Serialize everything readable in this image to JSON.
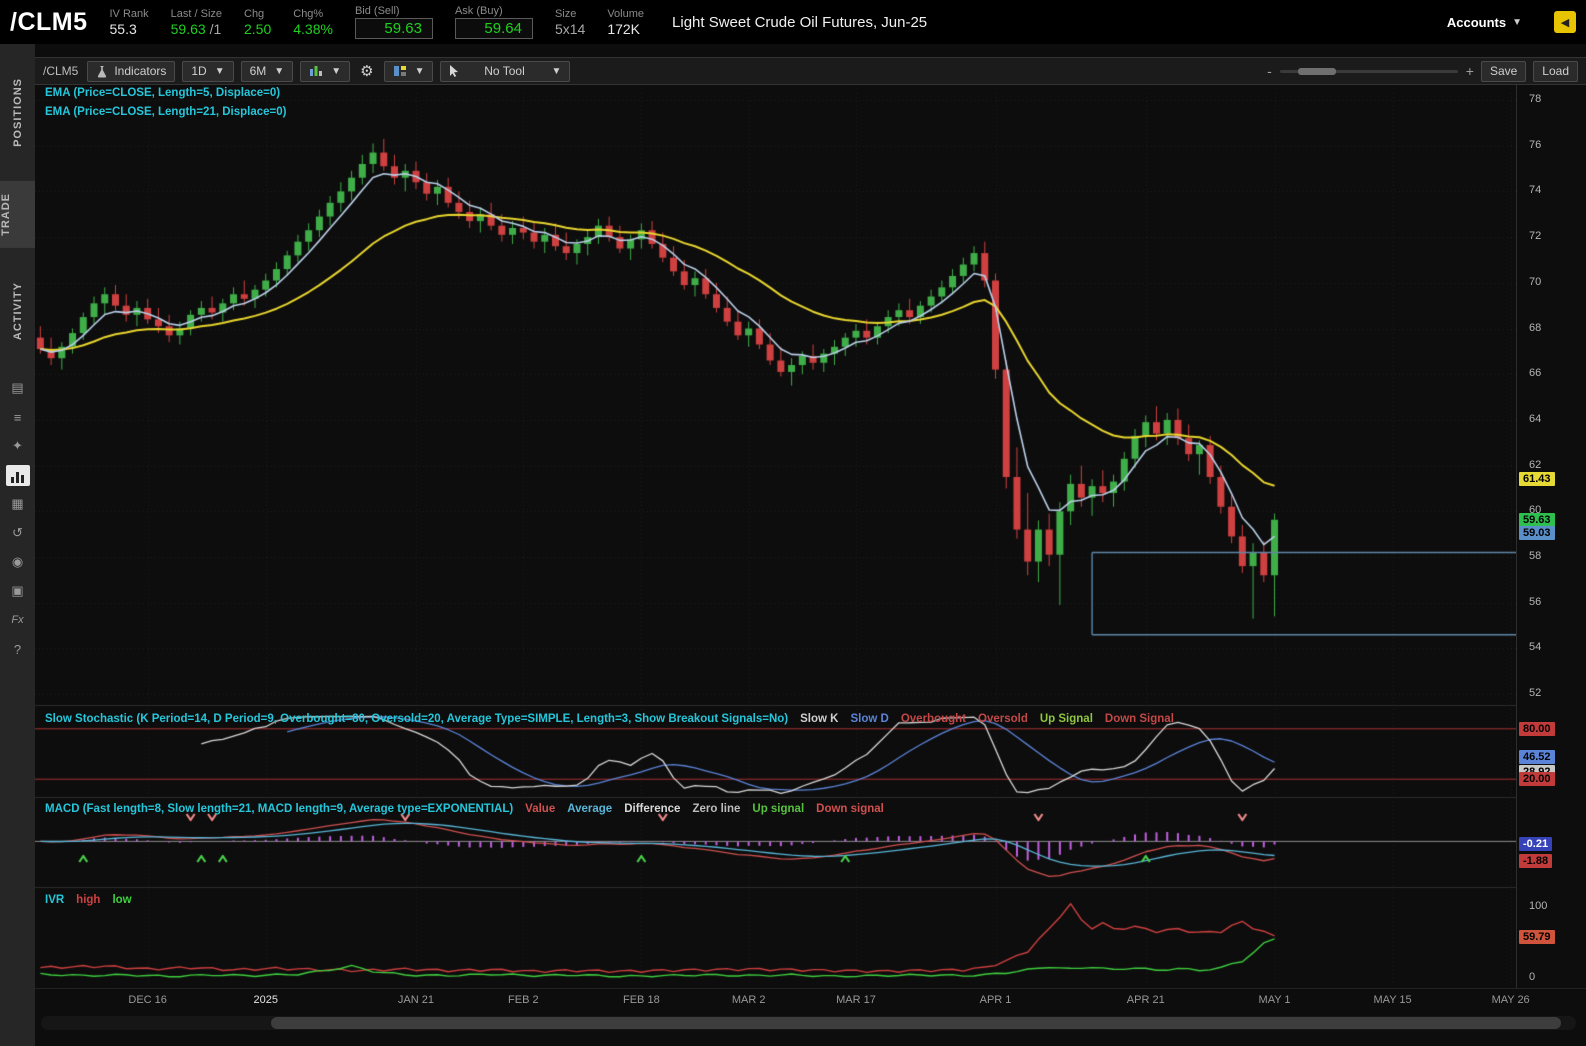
{
  "header": {
    "symbol": "/CLM5",
    "iv_rank_label": "IV Rank",
    "iv_rank": "55.3",
    "last_label": "Last / Size",
    "last": "59.63",
    "last_size": "/1",
    "chg_label": "Chg",
    "chg": "2.50",
    "chgpct_label": "Chg%",
    "chgpct": "4.38%",
    "bid_label": "Bid (Sell)",
    "bid": "59.63",
    "ask_label": "Ask (Buy)",
    "ask": "59.64",
    "size_label": "Size",
    "size": "5x14",
    "volume_label": "Volume",
    "volume": "172K",
    "description": "Light Sweet Crude Oil Futures, Jun-25",
    "accounts_label": "Accounts"
  },
  "sidebar": {
    "tabs": [
      {
        "label": "POSITIONS"
      },
      {
        "label": "TRADE"
      },
      {
        "label": "ACTIVITY"
      }
    ],
    "icons": [
      "calendar-icon",
      "watchlist-icon",
      "scan-icon",
      "chart-icon",
      "grid-icon",
      "history-icon",
      "community-icon",
      "products-icon",
      "formula-icon",
      "help-icon"
    ]
  },
  "toolbar": {
    "symbol_label": "/CLM5",
    "indicators_label": "Indicators",
    "timeframe": "1D",
    "range": "6M",
    "tool_label": "No Tool",
    "save_label": "Save",
    "load_label": "Load",
    "zoom_out": "-",
    "zoom_in": "+"
  },
  "chart_data": {
    "type": "candlestick",
    "symbol": "/CLM5",
    "timeframe": "1D",
    "range": "6M",
    "legend_color": "#26c6da",
    "colors": {
      "candle_up": "#3fae49",
      "candle_down": "#cf4040",
      "ema5_line": "#b9cfe8",
      "ema21_line": "#e8d52e",
      "drawing_line": "#5f87a8",
      "macd_histogram": "#c060e0"
    },
    "overlays": [
      {
        "name": "EMA 5",
        "legend": "EMA (Price=CLOSE, Length=5, Displace=0)",
        "length": 5,
        "color": "#b9cfe8"
      },
      {
        "name": "EMA 21",
        "legend": "EMA (Price=CLOSE, Length=21, Displace=0)",
        "length": 21,
        "color": "#e8d52e"
      }
    ],
    "price_axis": {
      "ticks": [
        78,
        76,
        74,
        72,
        70,
        68,
        66,
        64,
        62,
        60,
        58,
        56,
        54,
        52
      ],
      "badges": [
        {
          "text": "61.43",
          "price": 61.43,
          "bg": "#e6d835",
          "fg": "#000",
          "name": "ema21-value-badge"
        },
        {
          "text": "59.63",
          "price": 59.63,
          "bg": "#2fbf4f",
          "fg": "#000",
          "name": "last-price-badge"
        },
        {
          "text": "59.03",
          "price": 59.03,
          "bg": "#5b8fc9",
          "fg": "#000",
          "name": "ema5-value-badge"
        }
      ]
    },
    "drawings": {
      "upper_line_price": 58.2,
      "lower_line_price": 54.6,
      "start_index": 98
    },
    "x_axis": {
      "total_slots": 138,
      "ticks": [
        {
          "label": "DEC 16",
          "index": 10
        },
        {
          "label": "2025",
          "index": 21,
          "bright": true
        },
        {
          "label": "JAN 21",
          "index": 35
        },
        {
          "label": "FEB 2",
          "index": 45
        },
        {
          "label": "FEB 18",
          "index": 56
        },
        {
          "label": "MAR 2",
          "index": 66
        },
        {
          "label": "MAR 17",
          "index": 76
        },
        {
          "label": "APR 1",
          "index": 89
        },
        {
          "label": "APR 21",
          "index": 103
        },
        {
          "label": "MAY 1",
          "index": 115
        },
        {
          "label": "MAY 15",
          "index": 126
        },
        {
          "label": "MAY 26",
          "index": 137
        }
      ]
    },
    "candles": [
      [
        67.6,
        68.1,
        66.9,
        67.1
      ],
      [
        67.1,
        67.6,
        66.4,
        66.7
      ],
      [
        66.7,
        67.4,
        66.2,
        67.2
      ],
      [
        67.2,
        68.0,
        66.9,
        67.8
      ],
      [
        67.8,
        68.7,
        67.5,
        68.5
      ],
      [
        68.5,
        69.4,
        68.2,
        69.1
      ],
      [
        69.1,
        69.8,
        68.6,
        69.5
      ],
      [
        69.5,
        69.9,
        68.8,
        69.0
      ],
      [
        69.0,
        69.5,
        68.3,
        68.6
      ],
      [
        68.6,
        69.2,
        68.1,
        68.9
      ],
      [
        68.9,
        69.3,
        68.2,
        68.4
      ],
      [
        68.4,
        68.9,
        67.8,
        68.1
      ],
      [
        68.1,
        68.6,
        67.4,
        67.7
      ],
      [
        67.7,
        68.3,
        67.3,
        68.0
      ],
      [
        68.0,
        68.8,
        67.7,
        68.6
      ],
      [
        68.6,
        69.2,
        68.3,
        68.9
      ],
      [
        68.9,
        69.4,
        68.4,
        68.7
      ],
      [
        68.7,
        69.3,
        68.3,
        69.1
      ],
      [
        69.1,
        69.8,
        68.8,
        69.5
      ],
      [
        69.5,
        70.1,
        69.0,
        69.3
      ],
      [
        69.3,
        69.9,
        68.9,
        69.7
      ],
      [
        69.7,
        70.4,
        69.4,
        70.1
      ],
      [
        70.1,
        70.9,
        69.8,
        70.6
      ],
      [
        70.6,
        71.4,
        70.3,
        71.2
      ],
      [
        71.2,
        72.1,
        70.9,
        71.8
      ],
      [
        71.8,
        72.6,
        71.4,
        72.3
      ],
      [
        72.3,
        73.2,
        72.0,
        72.9
      ],
      [
        72.9,
        73.8,
        72.5,
        73.5
      ],
      [
        73.5,
        74.4,
        73.1,
        74.0
      ],
      [
        74.0,
        74.9,
        73.6,
        74.6
      ],
      [
        74.6,
        75.6,
        74.3,
        75.2
      ],
      [
        75.2,
        76.1,
        74.8,
        75.7
      ],
      [
        75.7,
        76.3,
        74.9,
        75.1
      ],
      [
        75.1,
        75.6,
        74.3,
        74.6
      ],
      [
        74.6,
        75.2,
        74.0,
        74.9
      ],
      [
        74.9,
        75.3,
        74.1,
        74.4
      ],
      [
        74.4,
        74.8,
        73.6,
        73.9
      ],
      [
        73.9,
        74.5,
        73.4,
        74.2
      ],
      [
        74.2,
        74.6,
        73.3,
        73.5
      ],
      [
        73.5,
        74.0,
        72.8,
        73.1
      ],
      [
        73.1,
        73.6,
        72.4,
        72.7
      ],
      [
        72.7,
        73.3,
        72.2,
        73.0
      ],
      [
        73.0,
        73.5,
        72.3,
        72.5
      ],
      [
        72.5,
        73.0,
        71.8,
        72.1
      ],
      [
        72.1,
        72.7,
        71.7,
        72.4
      ],
      [
        72.4,
        72.9,
        71.9,
        72.2
      ],
      [
        72.2,
        72.7,
        71.5,
        71.8
      ],
      [
        71.8,
        72.4,
        71.3,
        72.1
      ],
      [
        72.1,
        72.6,
        71.4,
        71.6
      ],
      [
        71.6,
        72.2,
        71.0,
        71.3
      ],
      [
        71.3,
        71.9,
        70.8,
        71.7
      ],
      [
        71.7,
        72.3,
        71.2,
        72.0
      ],
      [
        72.0,
        72.8,
        71.7,
        72.5
      ],
      [
        72.5,
        72.9,
        71.8,
        72.0
      ],
      [
        72.0,
        72.5,
        71.3,
        71.5
      ],
      [
        71.5,
        72.1,
        71.0,
        71.9
      ],
      [
        71.9,
        72.6,
        71.5,
        72.3
      ],
      [
        72.3,
        72.7,
        71.5,
        71.7
      ],
      [
        71.7,
        72.2,
        70.9,
        71.1
      ],
      [
        71.1,
        71.6,
        70.3,
        70.5
      ],
      [
        70.5,
        71.0,
        69.7,
        69.9
      ],
      [
        69.9,
        70.5,
        69.4,
        70.2
      ],
      [
        70.2,
        70.6,
        69.3,
        69.5
      ],
      [
        69.5,
        70.0,
        68.7,
        68.9
      ],
      [
        68.9,
        69.4,
        68.1,
        68.3
      ],
      [
        68.3,
        68.8,
        67.5,
        67.7
      ],
      [
        67.7,
        68.3,
        67.2,
        68.0
      ],
      [
        68.0,
        68.4,
        67.1,
        67.3
      ],
      [
        67.3,
        67.8,
        66.4,
        66.6
      ],
      [
        66.6,
        67.2,
        65.9,
        66.1
      ],
      [
        66.1,
        66.7,
        65.5,
        66.4
      ],
      [
        66.4,
        67.0,
        66.0,
        66.8
      ],
      [
        66.8,
        67.3,
        66.2,
        66.5
      ],
      [
        66.5,
        67.1,
        66.1,
        66.9
      ],
      [
        66.9,
        67.5,
        66.4,
        67.2
      ],
      [
        67.2,
        67.8,
        66.8,
        67.6
      ],
      [
        67.6,
        68.2,
        67.2,
        67.9
      ],
      [
        67.9,
        68.4,
        67.3,
        67.6
      ],
      [
        67.6,
        68.3,
        67.3,
        68.1
      ],
      [
        68.1,
        68.8,
        67.8,
        68.5
      ],
      [
        68.5,
        69.1,
        68.1,
        68.8
      ],
      [
        68.8,
        69.3,
        68.2,
        68.5
      ],
      [
        68.5,
        69.2,
        68.2,
        69.0
      ],
      [
        69.0,
        69.7,
        68.7,
        69.4
      ],
      [
        69.4,
        70.1,
        69.1,
        69.8
      ],
      [
        69.8,
        70.6,
        69.5,
        70.3
      ],
      [
        70.3,
        71.1,
        70.0,
        70.8
      ],
      [
        70.8,
        71.6,
        70.5,
        71.3
      ],
      [
        71.3,
        71.8,
        69.8,
        70.1
      ],
      [
        70.1,
        70.4,
        65.8,
        66.2
      ],
      [
        66.2,
        66.6,
        61.0,
        61.5
      ],
      [
        61.5,
        62.8,
        58.8,
        59.2
      ],
      [
        59.2,
        60.8,
        57.2,
        57.8
      ],
      [
        57.8,
        59.6,
        56.9,
        59.2
      ],
      [
        59.2,
        59.9,
        57.6,
        58.1
      ],
      [
        58.1,
        60.4,
        55.9,
        60.0
      ],
      [
        60.0,
        61.6,
        59.4,
        61.2
      ],
      [
        61.2,
        62.0,
        60.2,
        60.6
      ],
      [
        60.6,
        61.4,
        59.8,
        61.1
      ],
      [
        61.1,
        61.8,
        60.4,
        60.8
      ],
      [
        60.8,
        61.6,
        60.2,
        61.3
      ],
      [
        61.3,
        62.6,
        60.9,
        62.3
      ],
      [
        62.3,
        63.6,
        61.9,
        63.3
      ],
      [
        63.3,
        64.2,
        62.8,
        63.9
      ],
      [
        63.9,
        64.6,
        63.1,
        63.4
      ],
      [
        63.4,
        64.3,
        62.9,
        64.0
      ],
      [
        64.0,
        64.5,
        62.9,
        63.2
      ],
      [
        63.2,
        63.8,
        62.2,
        62.5
      ],
      [
        62.5,
        63.1,
        61.6,
        62.9
      ],
      [
        62.9,
        63.3,
        61.2,
        61.5
      ],
      [
        61.5,
        62.0,
        59.9,
        60.2
      ],
      [
        60.2,
        60.8,
        58.6,
        58.9
      ],
      [
        58.9,
        59.4,
        57.3,
        57.6
      ],
      [
        57.6,
        58.6,
        55.3,
        58.2
      ],
      [
        58.2,
        58.7,
        56.9,
        57.2
      ],
      [
        57.2,
        59.9,
        55.4,
        59.63
      ]
    ],
    "stochastic": {
      "legend": "Slow Stochastic (K Period=14, D Period=9, Overbought=80, Oversold=20, Average Type=SIMPLE, Length=3, Show Breakout Signals=No)",
      "legend_color": "#26c6da",
      "items": [
        {
          "label": "Slow K",
          "color": "#cfcfcf"
        },
        {
          "label": "Slow D",
          "color": "#5b84d8"
        },
        {
          "label": "Overbought",
          "color": "#c24848"
        },
        {
          "label": "Oversold",
          "color": "#c24848"
        },
        {
          "label": "Up Signal",
          "color": "#8fc63f"
        },
        {
          "label": "Down Signal",
          "color": "#c24848"
        }
      ],
      "k_period": 14,
      "d_period": 9,
      "slowing": 3,
      "overbought": 80,
      "oversold": 20,
      "badges": [
        {
          "text": "80.00",
          "value": 80,
          "bg": "#c23b3b",
          "fg": "#000"
        },
        {
          "text": "46.52",
          "value": 46.52,
          "bg": "#5b84d8",
          "fg": "#000"
        },
        {
          "text": "28.92",
          "value": 28.92,
          "bg": "#c8c8c8",
          "fg": "#000"
        },
        {
          "text": "20.00",
          "value": 20,
          "bg": "#c23b3b",
          "fg": "#000"
        }
      ]
    },
    "macd": {
      "legend": "MACD (Fast length=8, Slow length=21, MACD length=9, Average type=EXPONENTIAL)",
      "legend_color": "#26c6da",
      "items": [
        {
          "label": "Value",
          "color": "#d05050"
        },
        {
          "label": "Average",
          "color": "#58b6d8"
        },
        {
          "label": "Difference",
          "color": "#d8d8d8"
        },
        {
          "label": "Zero line",
          "color": "#bdbdbd"
        },
        {
          "label": "Up signal",
          "color": "#57c23f"
        },
        {
          "label": "Down signal",
          "color": "#d05050"
        }
      ],
      "fast": 8,
      "slow": 21,
      "signal": 9,
      "up_signals": [
        4,
        15,
        17,
        56,
        75,
        103
      ],
      "down_signals": [
        14,
        16,
        34,
        58,
        93,
        112
      ],
      "badges": [
        {
          "text": "-0.21",
          "value": -0.21,
          "bg": "#3642b8",
          "fg": "#fff"
        },
        {
          "text": "-1.88",
          "value": -1.88,
          "bg": "#c23b3b",
          "fg": "#000"
        }
      ]
    },
    "ivr": {
      "legend_title": "IVR",
      "legend_color": "#26c6da",
      "items": [
        {
          "label": "high",
          "color": "#d04040"
        },
        {
          "label": "low",
          "color": "#3fd03f"
        }
      ],
      "axis_max_label": "100",
      "axis_min_label": "0",
      "badge": {
        "text": "59.79",
        "value": 59.79,
        "bg": "#d0533b",
        "fg": "#000"
      },
      "y_max": 110,
      "high_points": [
        [
          0,
          17
        ],
        [
          6,
          19
        ],
        [
          10,
          15
        ],
        [
          14,
          17
        ],
        [
          18,
          14
        ],
        [
          22,
          16
        ],
        [
          26,
          14
        ],
        [
          30,
          13
        ],
        [
          34,
          15
        ],
        [
          38,
          13
        ],
        [
          42,
          14
        ],
        [
          46,
          12
        ],
        [
          50,
          13
        ],
        [
          54,
          12
        ],
        [
          58,
          13
        ],
        [
          62,
          14
        ],
        [
          66,
          15
        ],
        [
          70,
          14
        ],
        [
          74,
          13
        ],
        [
          78,
          12
        ],
        [
          82,
          13
        ],
        [
          86,
          14
        ],
        [
          88,
          17
        ],
        [
          90,
          26
        ],
        [
          92,
          40
        ],
        [
          94,
          70
        ],
        [
          95,
          88
        ],
        [
          96,
          104
        ],
        [
          97,
          82
        ],
        [
          98,
          72
        ],
        [
          99,
          78
        ],
        [
          100,
          70
        ],
        [
          102,
          73
        ],
        [
          104,
          67
        ],
        [
          106,
          70
        ],
        [
          108,
          65
        ],
        [
          110,
          67
        ],
        [
          111,
          74
        ],
        [
          112,
          80
        ],
        [
          113,
          72
        ],
        [
          114,
          66
        ],
        [
          115,
          60
        ]
      ],
      "low_points": [
        [
          0,
          8
        ],
        [
          4,
          6
        ],
        [
          8,
          7
        ],
        [
          12,
          5
        ],
        [
          16,
          7
        ],
        [
          20,
          6
        ],
        [
          24,
          8
        ],
        [
          27,
          14
        ],
        [
          29,
          19
        ],
        [
          31,
          12
        ],
        [
          34,
          7
        ],
        [
          38,
          6
        ],
        [
          42,
          8
        ],
        [
          46,
          6
        ],
        [
          50,
          7
        ],
        [
          54,
          5
        ],
        [
          58,
          6
        ],
        [
          62,
          7
        ],
        [
          66,
          6
        ],
        [
          70,
          7
        ],
        [
          74,
          5
        ],
        [
          78,
          6
        ],
        [
          82,
          7
        ],
        [
          86,
          6
        ],
        [
          88,
          7
        ],
        [
          90,
          10
        ],
        [
          92,
          14
        ],
        [
          94,
          18
        ],
        [
          96,
          15
        ],
        [
          98,
          18
        ],
        [
          100,
          14
        ],
        [
          102,
          17
        ],
        [
          104,
          13
        ],
        [
          106,
          16
        ],
        [
          108,
          13
        ],
        [
          110,
          17
        ],
        [
          112,
          26
        ],
        [
          113,
          38
        ],
        [
          114,
          50
        ],
        [
          115,
          56
        ]
      ]
    }
  }
}
